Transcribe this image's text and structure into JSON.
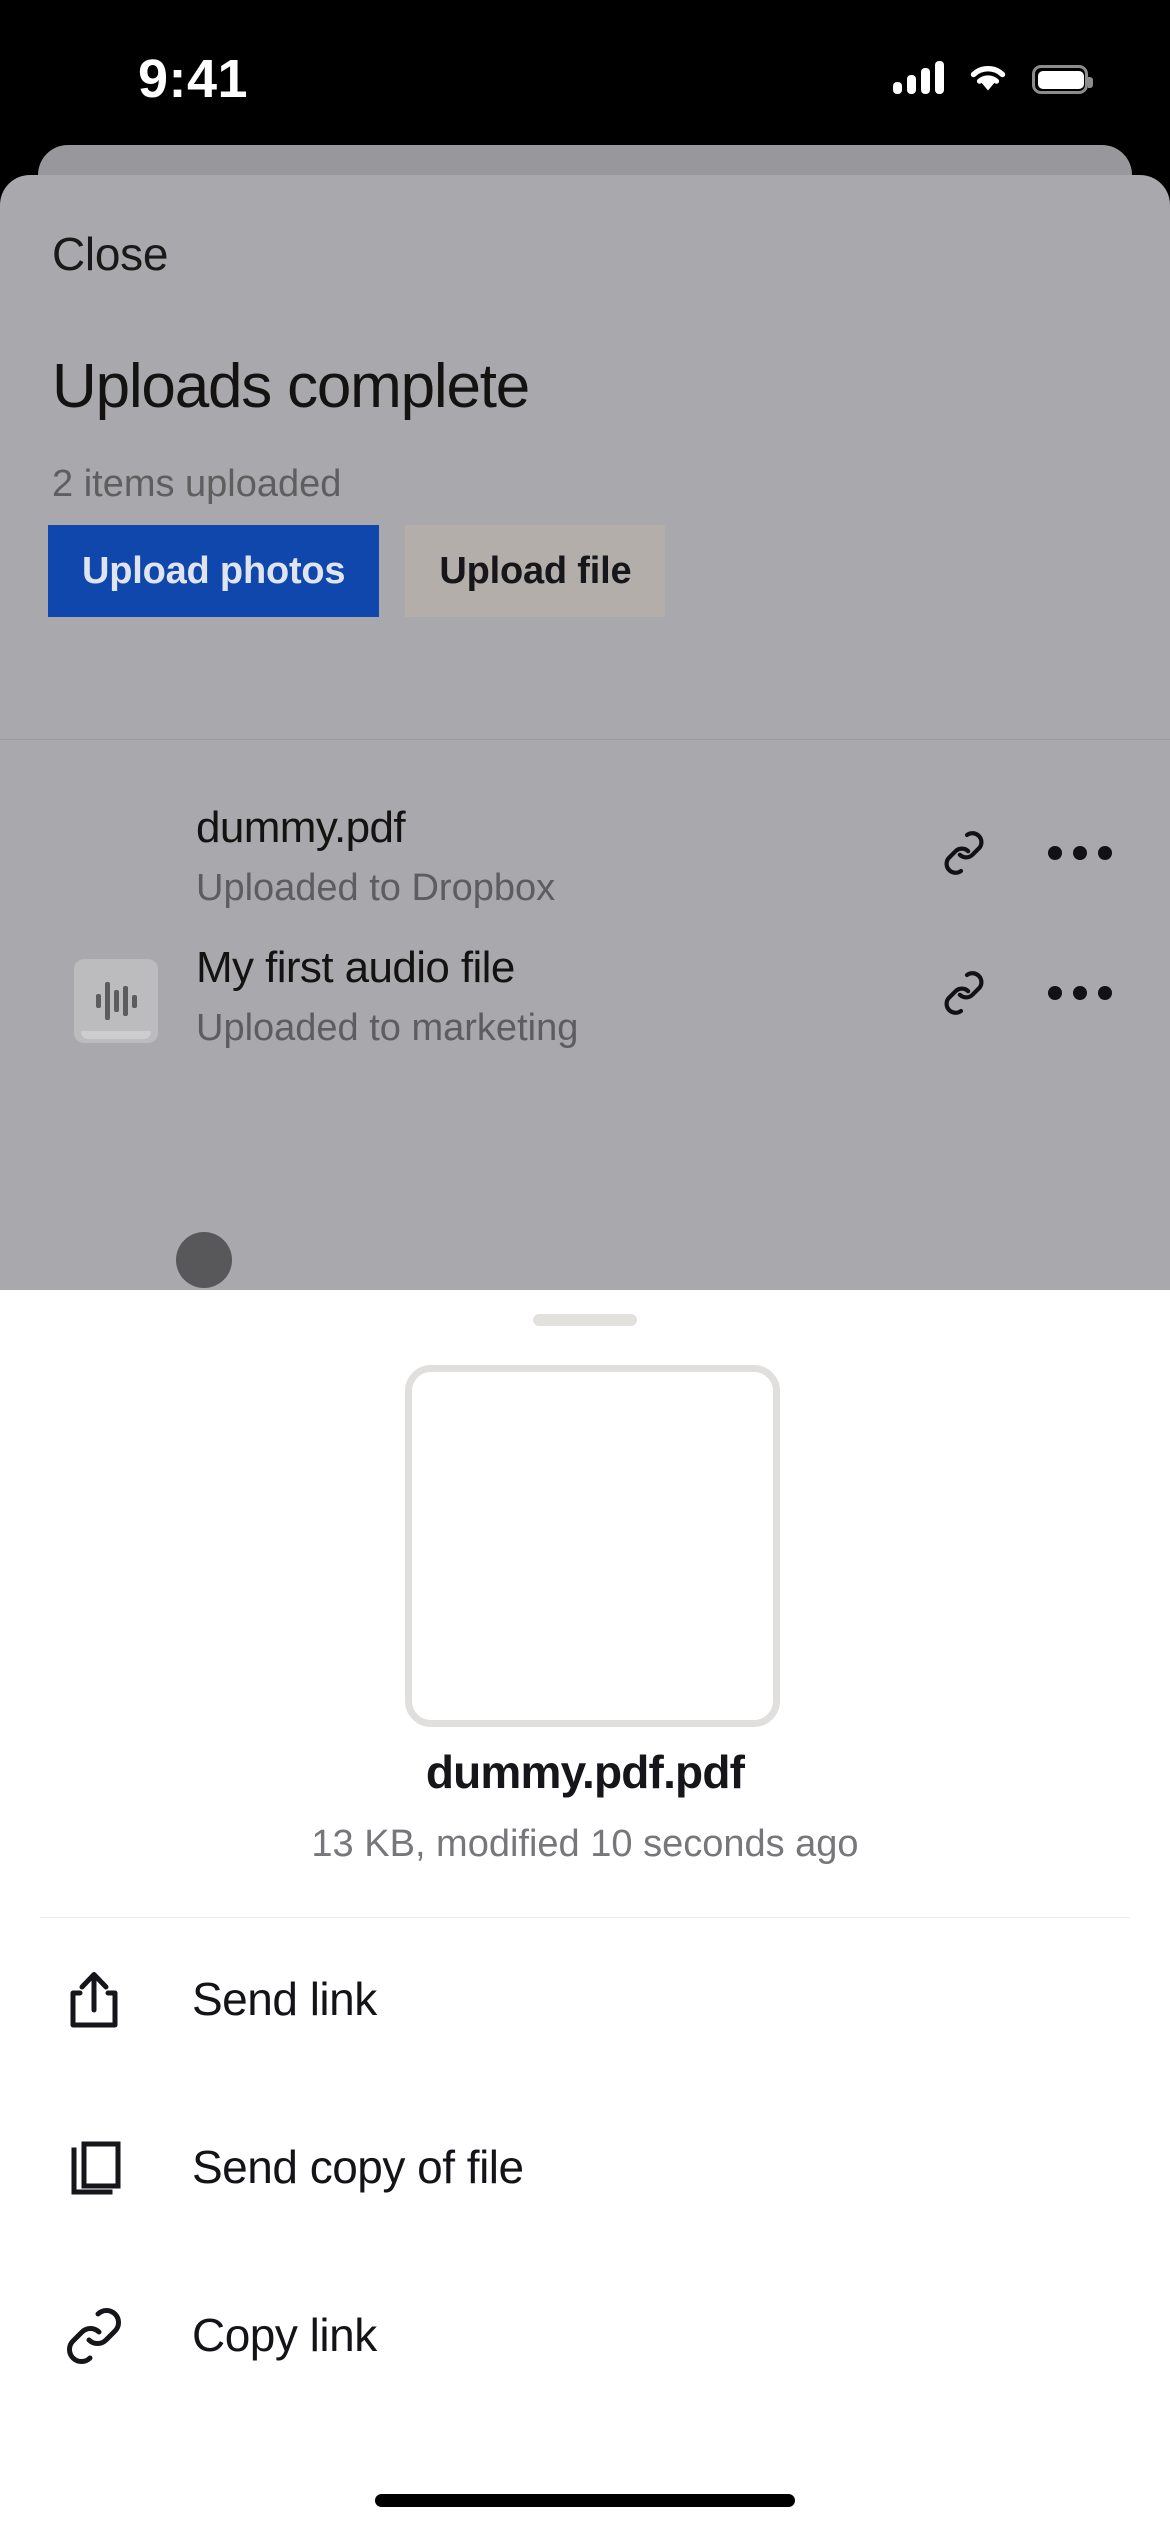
{
  "status_bar": {
    "time": "9:41",
    "cellular_icon": "cellular-signal-icon",
    "wifi_icon": "wifi-icon",
    "battery_icon": "battery-full-icon"
  },
  "upload_sheet": {
    "close_label": "Close",
    "title": "Uploads complete",
    "subtitle": "2 items uploaded",
    "buttons": [
      {
        "label": "Upload photos",
        "style": "primary",
        "color": "#0f47ad"
      },
      {
        "label": "Upload file",
        "style": "secondary",
        "color": "#b3aeaa"
      }
    ],
    "files": [
      {
        "name": "dummy.pdf",
        "status": "Uploaded to Dropbox",
        "thumbnail": "none",
        "link_icon": "link-icon",
        "more_icon": "more-ellipsis-icon"
      },
      {
        "name": "My first audio file",
        "status": "Uploaded to marketing",
        "thumbnail": "audio-waveform-icon",
        "link_icon": "link-icon",
        "more_icon": "more-ellipsis-icon"
      }
    ]
  },
  "action_sheet": {
    "grabber": "drag-handle",
    "preview_icon": "file-preview-placeholder",
    "file_name": "dummy.pdf.pdf",
    "file_meta": "13 KB, modified 10 seconds ago",
    "actions": [
      {
        "label": "Send link",
        "icon": "share-export-icon"
      },
      {
        "label": "Send copy of file",
        "icon": "copy-duplicate-icon"
      },
      {
        "label": "Copy link",
        "icon": "link-icon"
      }
    ]
  },
  "system": {
    "home_indicator": "home-indicator",
    "touch_indicator": "touch-point"
  }
}
